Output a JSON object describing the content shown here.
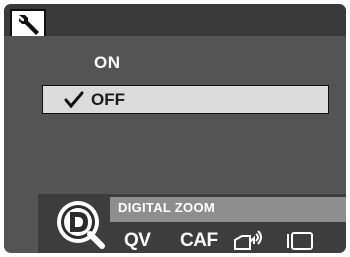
{
  "header": {
    "tab_icon": "wrench-icon"
  },
  "menu": {
    "options": [
      {
        "label": "ON",
        "selected": false
      },
      {
        "label": "OFF",
        "selected": true
      }
    ],
    "check_icon": "checkmark-icon"
  },
  "footer": {
    "mode_icon": "digital-zoom-d-icon",
    "caption": "DIGITAL ZOOM",
    "items": [
      {
        "label": "QV",
        "icon": "quick-view-icon"
      },
      {
        "label": "CAF",
        "icon": "continuous-af-icon"
      },
      {
        "label": "",
        "icon": "hand-signal-icon"
      },
      {
        "label": "",
        "icon": "screen-frame-icon"
      }
    ]
  },
  "colors": {
    "panel": "#545454",
    "topbar": "#3a3a3a",
    "highlight": "#dcdcdc",
    "caption_strip": "#8e8e8e",
    "bottom_bar": "#3d3d3d"
  }
}
